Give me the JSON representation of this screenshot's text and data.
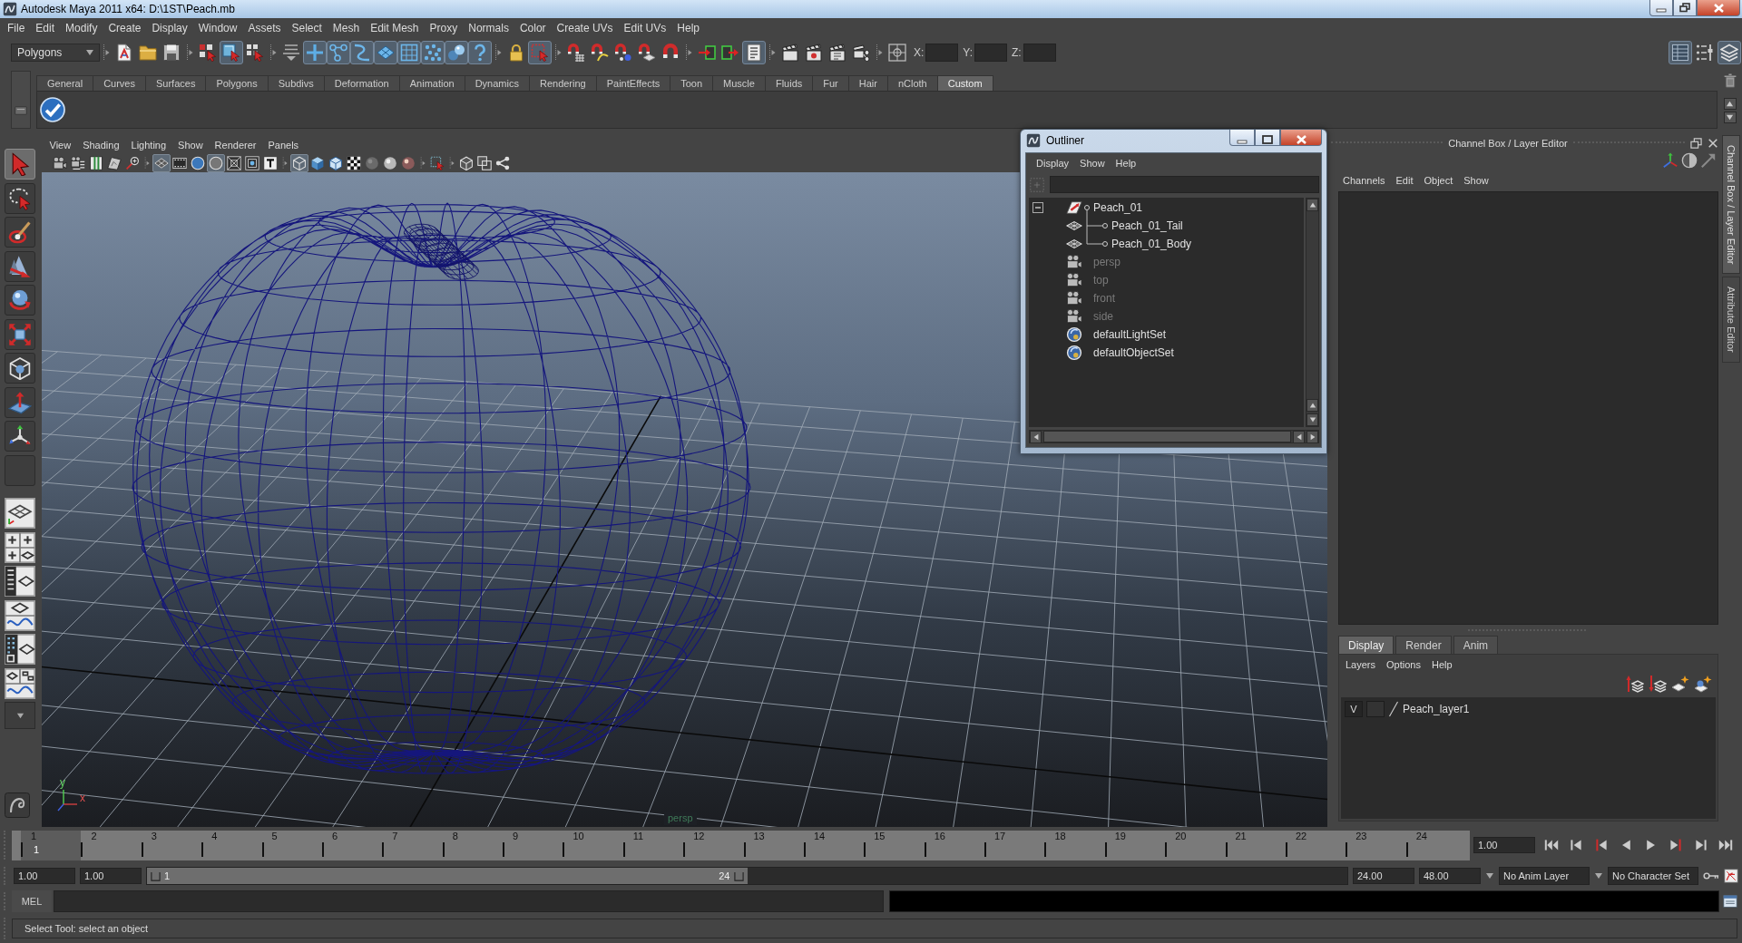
{
  "window": {
    "title": "Autodesk Maya 2011 x64: D:\\1ST\\Peach.mb"
  },
  "menu_bar": [
    "File",
    "Edit",
    "Modify",
    "Create",
    "Display",
    "Window",
    "Assets",
    "Select",
    "Mesh",
    "Edit Mesh",
    "Proxy",
    "Normals",
    "Color",
    "Create UVs",
    "Edit UVs",
    "Help"
  ],
  "status_line": {
    "mode": "Polygons",
    "buttons": [
      {
        "on": false
      },
      {
        "on": false
      },
      {
        "on": false
      },
      {
        "on": false
      },
      {
        "on": true
      },
      {
        "on": false
      },
      {
        "on": false
      },
      {
        "on": true
      },
      {
        "on": true
      },
      {
        "on": true
      },
      {
        "on": true
      },
      {
        "on": true
      },
      {
        "on": true
      },
      {
        "on": true
      },
      {
        "on": true
      },
      {
        "on": false
      },
      {
        "on": true
      },
      {
        "on": false
      },
      {
        "on": false
      },
      {
        "on": false
      },
      {
        "on": false
      },
      {
        "on": false
      },
      {
        "on": false
      },
      {
        "on": false
      },
      {
        "on": true
      },
      {
        "on": false
      },
      {
        "on": false
      },
      {
        "on": false
      },
      {
        "on": false
      },
      {
        "on": false
      }
    ],
    "coordinates": [
      "X:",
      "Y:",
      "Z:"
    ],
    "panel_toggles": [
      {
        "on": true
      },
      {
        "on": false
      },
      {
        "on": true
      }
    ]
  },
  "shelf": {
    "tabs": [
      {
        "label": "General",
        "selected": false
      },
      {
        "label": "Curves",
        "selected": false
      },
      {
        "label": "Surfaces",
        "selected": false
      },
      {
        "label": "Polygons",
        "selected": false
      },
      {
        "label": "Subdivs",
        "selected": false
      },
      {
        "label": "Deformation",
        "selected": false
      },
      {
        "label": "Animation",
        "selected": false
      },
      {
        "label": "Dynamics",
        "selected": false
      },
      {
        "label": "Rendering",
        "selected": false
      },
      {
        "label": "PaintEffects",
        "selected": false
      },
      {
        "label": "Toon",
        "selected": false
      },
      {
        "label": "Muscle",
        "selected": false
      },
      {
        "label": "Fluids",
        "selected": false
      },
      {
        "label": "Fur",
        "selected": false
      },
      {
        "label": "Hair",
        "selected": false
      },
      {
        "label": "nCloth",
        "selected": false
      },
      {
        "label": "Custom",
        "selected": true
      }
    ]
  },
  "toolbox": {
    "tools": [
      {
        "selected": true
      },
      {
        "selected": false
      },
      {
        "selected": false
      },
      {
        "selected": false
      },
      {
        "selected": false
      },
      {
        "selected": false
      },
      {
        "selected": false
      },
      {
        "selected": false
      },
      {
        "selected": false
      },
      {
        "selected": false
      }
    ]
  },
  "viewport": {
    "menu": [
      "View",
      "Shading",
      "Lighting",
      "Show",
      "Renderer",
      "Panels"
    ],
    "toolbar": [
      {
        "on": false
      },
      {
        "on": false
      },
      {
        "on": false
      },
      {
        "on": false
      },
      {
        "on": false
      },
      {
        "on": true
      },
      {
        "on": false
      },
      {
        "on": false
      },
      {
        "on": true
      },
      {
        "on": false
      },
      {
        "on": false
      },
      {
        "on": false
      },
      {
        "on": true
      },
      {
        "on": false
      },
      {
        "on": false
      },
      {
        "on": false
      },
      {
        "on": false
      },
      {
        "on": false
      },
      {
        "on": false
      },
      {
        "on": false
      },
      {
        "on": false
      },
      {
        "on": false
      },
      {
        "on": false
      }
    ],
    "camera": "persp",
    "axis_labels": [
      "y",
      "x"
    ]
  },
  "outliner": {
    "title": "Outliner",
    "menu": [
      "Display",
      "Show",
      "Help"
    ],
    "items": [
      {
        "name": "Peach_01",
        "kind": "transform",
        "expanded": true,
        "dimmed": false,
        "children": [
          {
            "name": "Peach_01_Tail",
            "kind": "mesh",
            "dimmed": false
          },
          {
            "name": "Peach_01_Body",
            "kind": "mesh",
            "dimmed": false
          }
        ]
      },
      {
        "name": "persp",
        "kind": "camera",
        "dimmed": true
      },
      {
        "name": "top",
        "kind": "camera",
        "dimmed": true
      },
      {
        "name": "front",
        "kind": "camera",
        "dimmed": true
      },
      {
        "name": "side",
        "kind": "camera",
        "dimmed": true
      },
      {
        "name": "defaultLightSet",
        "kind": "set",
        "dimmed": false
      },
      {
        "name": "defaultObjectSet",
        "kind": "set",
        "dimmed": false
      }
    ]
  },
  "channel_box": {
    "title": "Channel Box / Layer Editor",
    "menu": [
      "Channels",
      "Edit",
      "Object",
      "Show"
    ]
  },
  "layer_editor": {
    "tabs": [
      {
        "label": "Display",
        "selected": true
      },
      {
        "label": "Render",
        "selected": false
      },
      {
        "label": "Anim",
        "selected": false
      }
    ],
    "menu": [
      "Layers",
      "Options",
      "Help"
    ],
    "layers": [
      {
        "visibility": "V",
        "name": "Peach_layer1"
      }
    ]
  },
  "side_tabs": [
    {
      "label": "Channel Box / Layer Editor",
      "selected": true
    },
    {
      "label": "Attribute Editor",
      "selected": false
    }
  ],
  "time_slider": {
    "frames": [
      {
        "label": "1",
        "selected": true
      },
      {
        "label": "2",
        "selected": false
      },
      {
        "label": "3",
        "selected": false
      },
      {
        "label": "4",
        "selected": false
      },
      {
        "label": "5",
        "selected": false
      },
      {
        "label": "6",
        "selected": false
      },
      {
        "label": "7",
        "selected": false
      },
      {
        "label": "8",
        "selected": false
      },
      {
        "label": "9",
        "selected": false
      },
      {
        "label": "10",
        "selected": false
      },
      {
        "label": "11",
        "selected": false
      },
      {
        "label": "12",
        "selected": false
      },
      {
        "label": "13",
        "selected": false
      },
      {
        "label": "14",
        "selected": false
      },
      {
        "label": "15",
        "selected": false
      },
      {
        "label": "16",
        "selected": false
      },
      {
        "label": "17",
        "selected": false
      },
      {
        "label": "18",
        "selected": false
      },
      {
        "label": "19",
        "selected": false
      },
      {
        "label": "20",
        "selected": false
      },
      {
        "label": "21",
        "selected": false
      },
      {
        "label": "22",
        "selected": false
      },
      {
        "label": "23",
        "selected": false
      },
      {
        "label": "24",
        "selected": false
      }
    ],
    "current_frame": "1",
    "current_time": "1.00"
  },
  "range_slider": {
    "start_time": "1.00",
    "range_start": "1.00",
    "range_start_label": "1",
    "range_end_label": "24",
    "level": 0.5,
    "range_end": "24.00",
    "end_time": "48.00",
    "anim_layer": "No Anim Layer",
    "character_set": "No Character Set"
  },
  "command_line": {
    "language": "MEL"
  },
  "help_line": "Select Tool: select an object"
}
